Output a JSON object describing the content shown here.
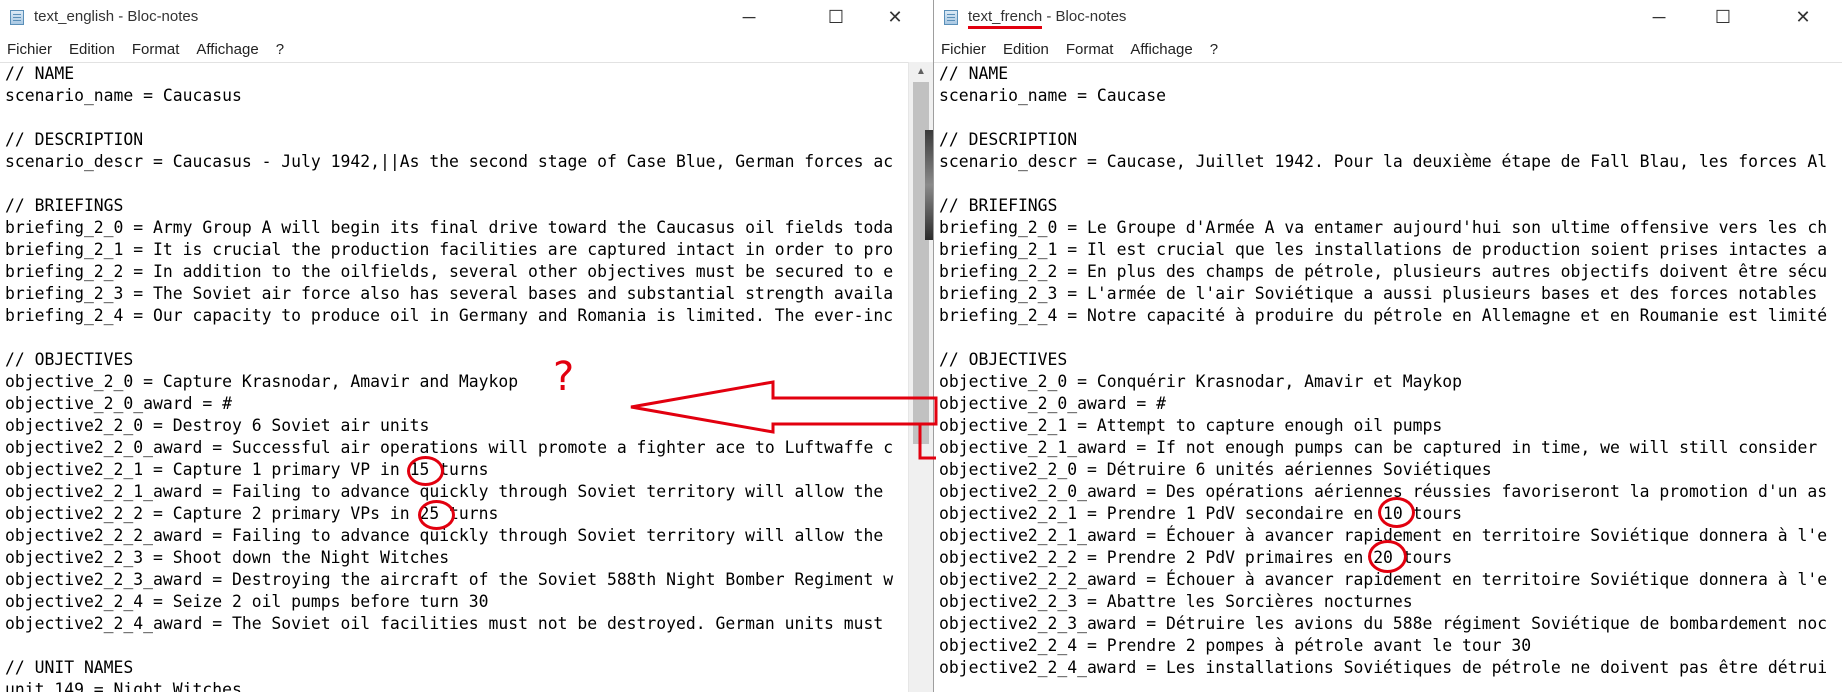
{
  "left_window": {
    "title": "text_english - Bloc-notes",
    "menu": [
      "Fichier",
      "Edition",
      "Format",
      "Affichage",
      "?"
    ],
    "lines": [
      "// NAME",
      "scenario_name = Caucasus",
      "",
      "// DESCRIPTION",
      "scenario_descr = Caucasus - July 1942,||As the second stage of Case Blue, German forces ac",
      "",
      "// BRIEFINGS",
      "briefing_2_0 = Army Group A will begin its final drive toward the Caucasus oil fields toda",
      "briefing_2_1 = It is crucial the production facilities are captured intact in order to pro",
      "briefing_2_2 = In addition to the oilfields, several other objectives must be secured to e",
      "briefing_2_3 = The Soviet air force also has several bases and substantial strength availa",
      "briefing_2_4 = Our capacity to produce oil in Germany and Romania is limited. The ever-inc",
      "",
      "// OBJECTIVES",
      "objective_2_0 = Capture Krasnodar, Amavir and Maykop",
      "objective_2_0_award = #",
      "objective2_2_0 = Destroy 6 Soviet air units",
      "objective2_2_0_award = Successful air operations will promote a fighter ace to Luftwaffe c",
      "objective2_2_1 = Capture 1 primary VP in 15 turns",
      "objective2_2_1_award = Failing to advance quickly through Soviet territory will allow the",
      "objective2_2_2 = Capture 2 primary VPs in 25 turns",
      "objective2_2_2_award = Failing to advance quickly through Soviet territory will allow the",
      "objective2_2_3 = Shoot down the Night Witches",
      "objective2_2_3_award = Destroying the aircraft of the Soviet 588th Night Bomber Regiment w",
      "objective2_2_4 = Seize 2 oil pumps before turn 30",
      "objective2_2_4_award = The Soviet oil facilities must not be destroyed. German units must",
      "",
      "// UNIT NAMES",
      "unit_149 = Night Witches"
    ]
  },
  "right_window": {
    "title_file": "text_french",
    "title_app": " - Bloc-notes",
    "menu": [
      "Fichier",
      "Edition",
      "Format",
      "Affichage",
      "?"
    ],
    "lines": [
      "// NAME",
      "scenario_name = Caucase",
      "",
      "// DESCRIPTION",
      "scenario_descr = Caucase, Juillet 1942. Pour la deuxième étape de Fall Blau, les forces Al",
      "",
      "// BRIEFINGS",
      "briefing_2_0 = Le Groupe d'Armée A va entamer aujourd'hui son ultime offensive vers les ch",
      "briefing_2_1 = Il est crucial que les installations de production soient prises intactes a",
      "briefing_2_2 = En plus des champs de pétrole, plusieurs autres objectifs doivent être sécu",
      "briefing_2_3 = L'armée de l'air Soviétique a aussi plusieurs bases et des forces notables",
      "briefing_2_4 = Notre capacité à produire du pétrole en Allemagne et en Roumanie est limité",
      "",
      "// OBJECTIVES",
      "objective_2_0 = Conquérir Krasnodar, Amavir et Maykop",
      "objective_2_0_award = #",
      "objective_2_1 = Attempt to capture enough oil pumps",
      "objective_2_1_award = If not enough pumps can be captured in time, we will still consider",
      "objective2_2_0 = Détruire 6 unités aériennes Soviétiques",
      "objective2_2_0_award = Des opérations aériennes réussies favoriseront la promotion d'un as",
      "objective2_2_1 = Prendre 1 PdV secondaire en 10 tours",
      "objective2_2_1_award = Échouer à avancer rapidement en territoire Soviétique donnera à l'e",
      "objective2_2_2 = Prendre 2 PdV primaires en 20 tours",
      "objective2_2_2_award = Échouer à avancer rapidement en territoire Soviétique donnera à l'e",
      "objective2_2_3 = Abattre les Sorcières nocturnes",
      "objective2_2_3_award = Détruire les avions du 588e régiment Soviétique de bombardement noc",
      "objective2_2_4 = Prendre 2 pompes à pétrole avant le tour 30",
      "objective2_2_4_award = Les installations Soviétiques de pétrole ne doivent pas être détrui"
    ]
  },
  "annotation": {
    "question_mark": "?",
    "color": "#e2000f"
  },
  "icons": {
    "minimize": "minimize-icon",
    "maximize": "maximize-icon",
    "close": "close-icon",
    "scroll_up": "scroll-up-arrow-icon"
  }
}
